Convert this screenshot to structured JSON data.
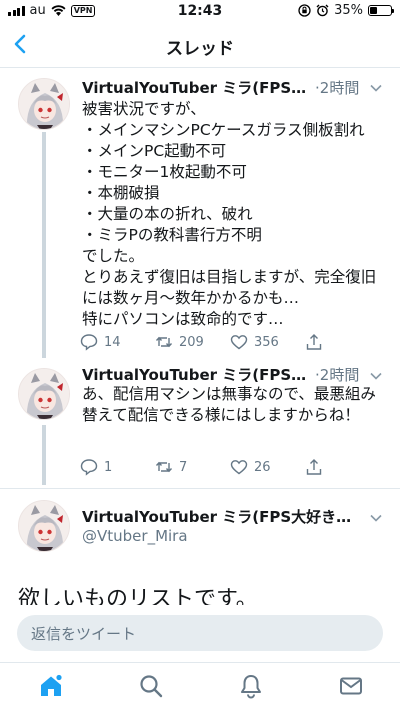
{
  "status": {
    "carrier": "au",
    "vpn": "VPN",
    "time": "12:43",
    "battery": "35%",
    "battery_level": 0.35
  },
  "nav": {
    "title": "スレッド"
  },
  "tweets": [
    {
      "name": "VirtualYouTuber ミラ(FPS大…",
      "dot": "·",
      "time": "2時間",
      "text": "被害状況ですが、\n・メインマシンPCケースガラス側板割れ\n・メインPC起動不可\n・モニター1枚起動不可\n・本棚破損\n・大量の本の折れ、破れ\n・ミラPの教科書行方不明\nでした。\nとりあえず復旧は目指しますが、完全復旧には数ヶ月〜数年かかるかも…\n特にパソコンは致命的です…",
      "replies": "14",
      "retweets": "209",
      "likes": "356"
    },
    {
      "name": "VirtualYouTuber ミラ(FPS大…",
      "dot": "·",
      "time": "2時間",
      "text": "あ、配信用マシンは無事なので、最悪組み替えて配信できる様にはしますからね！",
      "replies": "1",
      "retweets": "7",
      "likes": "26"
    },
    {
      "name": "VirtualYouTuber ミラ(FPS大好き…",
      "handle": "@Vtuber_Mira",
      "text": "欲しいものリストです。"
    }
  ],
  "reply": {
    "placeholder": "返信をツイート"
  },
  "tabs": [
    "home-icon",
    "search-icon",
    "notifications-icon",
    "messages-icon"
  ],
  "colors": {
    "accent": "#1da1f2",
    "muted": "#657786",
    "thread_line": "#ccd6dd"
  }
}
